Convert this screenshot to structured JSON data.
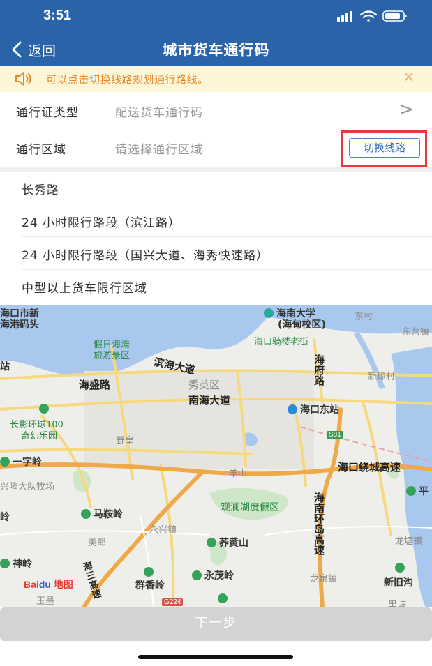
{
  "status_bar": {
    "time": "3:51",
    "icons": [
      "signal-icon",
      "wifi-icon",
      "battery-icon"
    ]
  },
  "nav": {
    "back_label": "返回",
    "title": "城市货车通行码"
  },
  "notice": {
    "text": "可以点击切换线路规划通行路线。",
    "close": "×",
    "icon": "speaker-icon"
  },
  "form": {
    "permit_type": {
      "label": "通行证类型",
      "value": "配送货车通行码",
      "chevron": ">"
    },
    "area": {
      "label": "通行区域",
      "placeholder": "请选择通行区域",
      "switch_button": "切换线路"
    }
  },
  "routes": [
    "长秀路",
    "24 小时限行路段（滨江路）",
    "24 小时限行路段（国兴大道、海秀快速路）",
    "中型以上货车限行区域"
  ],
  "map": {
    "provider": "Bai du 地图",
    "labels": {
      "haikou_port_1": "海口市新",
      "haikou_port_2": "海港码头",
      "hainan_univ_1": "海南大学",
      "hainan_univ_2": "(海甸校区)",
      "dongcun": "东村",
      "dongying": "东营镇",
      "jiari_1": "假日海滩",
      "jiari_2": "旅游景区",
      "qilou": "海口骑楼老街",
      "binhai": "滨海大道",
      "haifu": "海府路",
      "xinqiongcun": "新琼村",
      "zhan": "站",
      "haisheng": "海盛路",
      "xiuying": "秀英区",
      "nanhai": "南海大道",
      "dongzhan": "海口东站",
      "changying_1": "长影环球100",
      "changying_2": "奇幻乐园",
      "yehuang": "野皇",
      "s81": "S81",
      "yiziling": "一字岭",
      "yangshan": "羊山",
      "ring_expressway": "海口绕城高速",
      "ping": "平",
      "xinglong": "兴隆大队牧场",
      "guanlan": "观澜湖度假区",
      "ling": "岭",
      "maanling": "马鞍岭",
      "huannan_1": "海南环岛高速",
      "yongxing": "永兴镇",
      "meilang": "美郎",
      "qihuangshan": "荞黄山",
      "longtang": "龙塘镇",
      "shenling": "神岭",
      "yongmaoling": "永茂岭",
      "longquan": "龙泉镇",
      "xinjiugou": "新旧沟",
      "qunxiangling": "群香岭",
      "haisan": "海三高速",
      "g224": "G224",
      "yuxia": "玉墨",
      "heitang": "黑塘"
    }
  },
  "next_button": "下一步",
  "colors": {
    "header": "#2b63a8",
    "notice_bg": "#fdf5d8",
    "notice_text": "#e58a2a",
    "highlight_border": "#e53a3a",
    "switch_button": "#2f6cb6",
    "next_button_disabled": "#d3d3d6"
  }
}
